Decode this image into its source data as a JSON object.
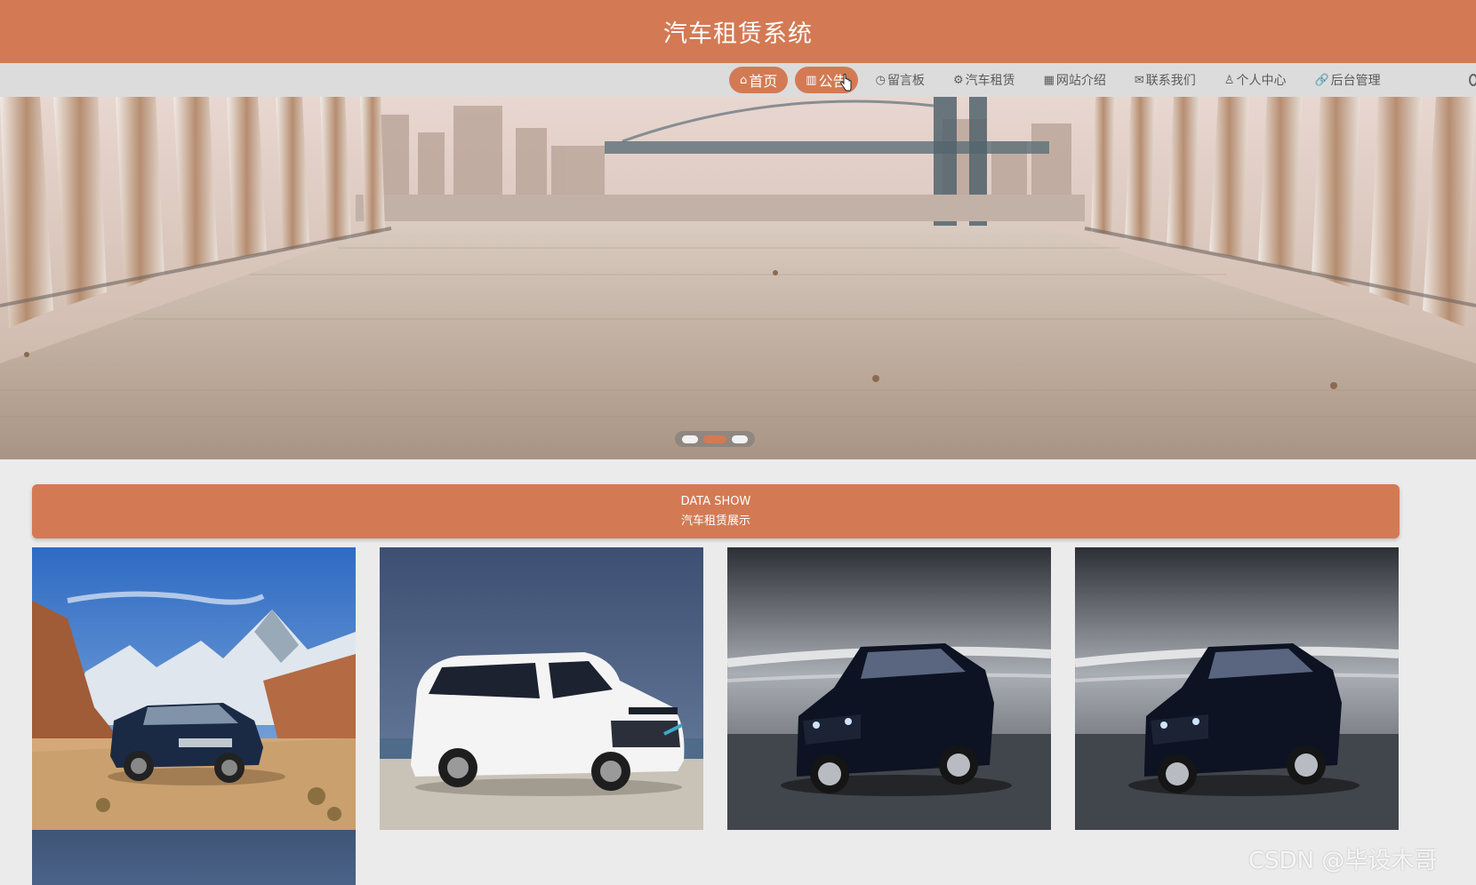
{
  "header": {
    "title": "汽车租赁系统"
  },
  "nav": {
    "items": [
      {
        "icon": "home-icon",
        "glyph": "⌂",
        "label": "首页"
      },
      {
        "icon": "notice-icon",
        "glyph": "▥",
        "label": "公告"
      },
      {
        "icon": "message-icon",
        "glyph": "◷",
        "label": "留言板"
      },
      {
        "icon": "car-rent-icon",
        "glyph": "⚙",
        "label": "汽车租赁"
      },
      {
        "icon": "site-intro-icon",
        "glyph": "▦",
        "label": "网站介绍"
      },
      {
        "icon": "contact-icon",
        "glyph": "✉",
        "label": "联系我们"
      },
      {
        "icon": "user-icon",
        "glyph": "♙",
        "label": "个人中心"
      },
      {
        "icon": "link-icon",
        "glyph": "🔗",
        "label": "后台管理"
      }
    ]
  },
  "carousel": {
    "active_index": 1,
    "count": 3
  },
  "section": {
    "title_en": "DATA SHOW",
    "title_cn": "汽车租赁展示"
  },
  "watermark": "CSDN @毕设木哥",
  "colors": {
    "accent": "#d37a54",
    "nav_bg": "#dcdcdc",
    "page_bg": "#ebebeb"
  }
}
